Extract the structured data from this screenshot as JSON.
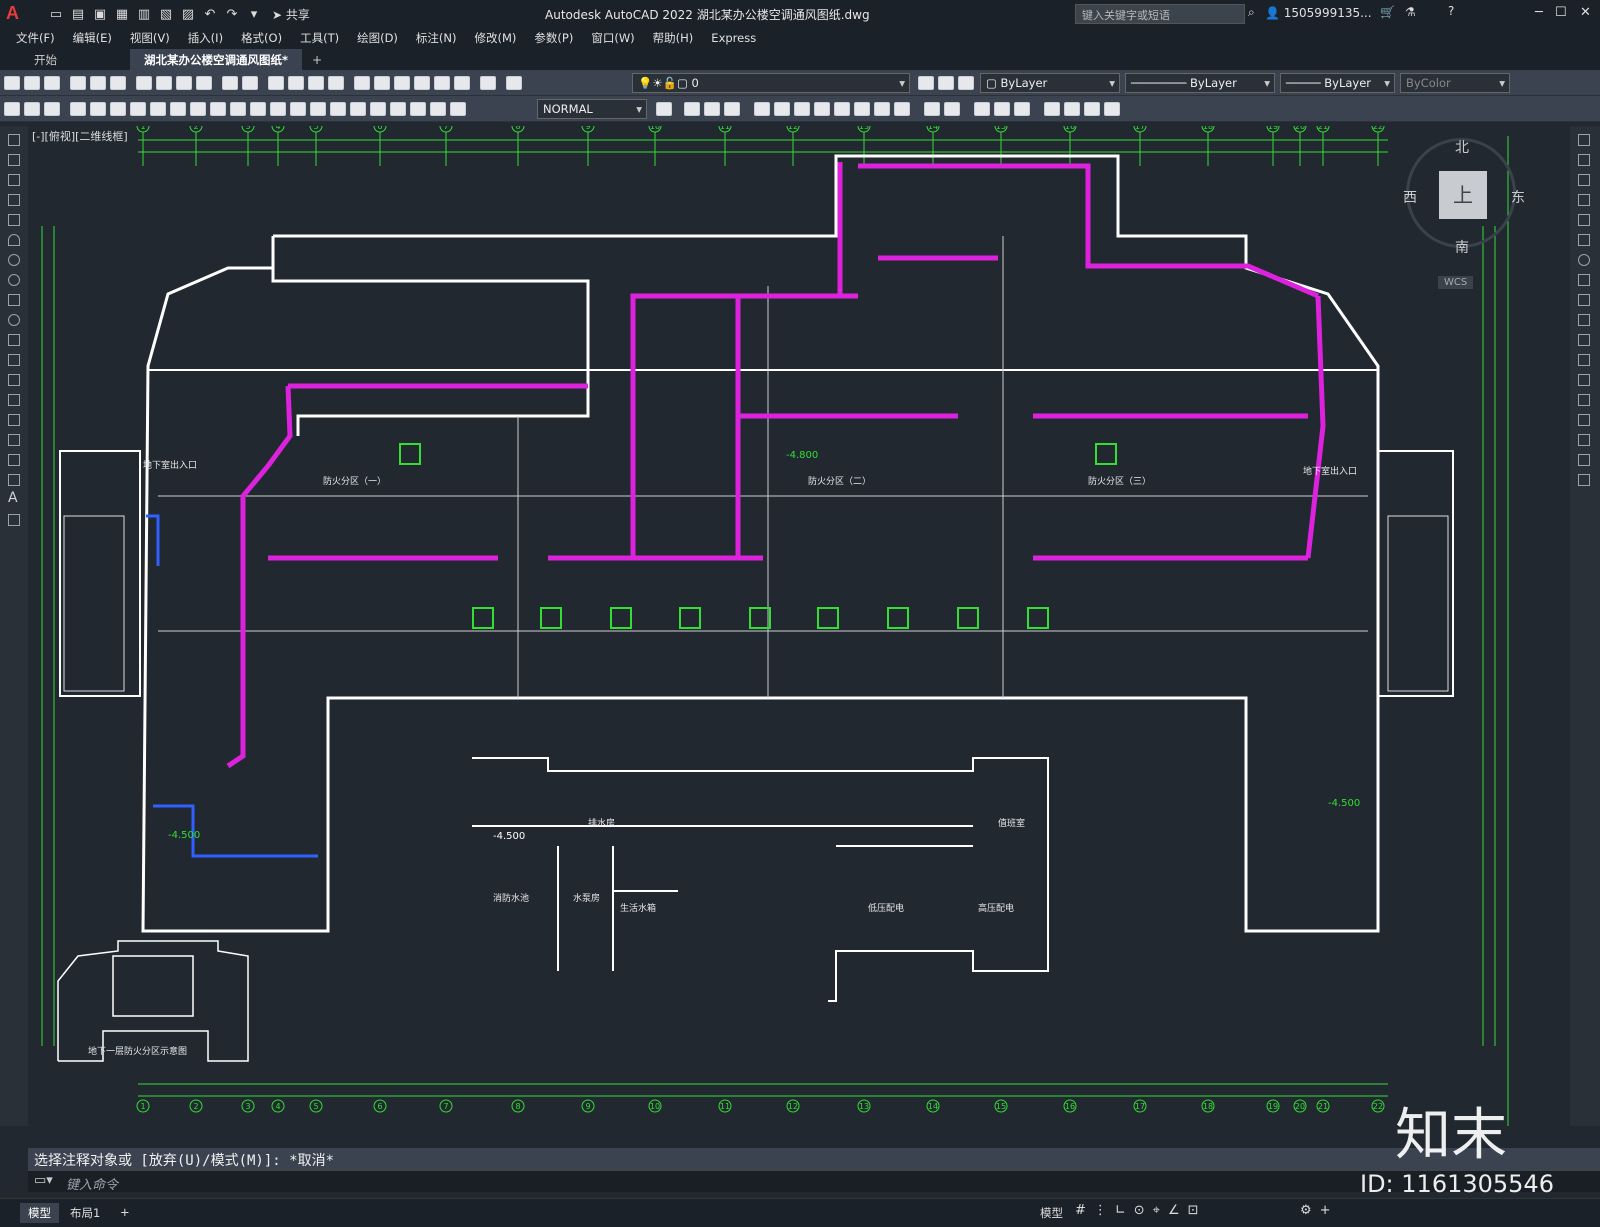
{
  "titlebar": {
    "logo": "A",
    "share": "共享",
    "title": "Autodesk AutoCAD 2022    湖北某办公楼空调通风图纸.dwg",
    "search_placeholder": "键入关键字或短语",
    "user": "1505999135...",
    "min": "─",
    "max": "☐",
    "close": "✕"
  },
  "menu": [
    "文件(F)",
    "编辑(E)",
    "视图(V)",
    "插入(I)",
    "格式(O)",
    "工具(T)",
    "绘图(D)",
    "标注(N)",
    "修改(M)",
    "参数(P)",
    "窗口(W)",
    "帮助(H)",
    "Express"
  ],
  "tabs": {
    "start": "开始",
    "doc": "湖北某办公楼空调通风图纸*",
    "add": "+"
  },
  "layer_combo": "0",
  "color_combo": "ByLayer",
  "linetype_combo": "ByLayer",
  "lineweight_combo": "ByLayer",
  "plotstyle_combo": "ByColor",
  "style_combo": "NORMAL",
  "viewport_label": "[-][俯视][二维线框]",
  "viewcube": {
    "north": "北",
    "south": "南",
    "east": "东",
    "west": "西",
    "top": "上",
    "wcs": "WCS"
  },
  "drawing": {
    "level1": "-4.800",
    "level2": "-4.500",
    "level3": "-4.500",
    "level4": "-4.500",
    "zone1": "防火分区（一）",
    "zone2": "防火分区（二）",
    "zone3": "防火分区（三）",
    "entry_left": "地下室出入口",
    "entry_right": "地下室出入口",
    "room1": "消防水池",
    "room2": "水泵房",
    "room3": "生活水箱",
    "room4": "低压配电",
    "room5": "高压配电",
    "room6": "值班室",
    "room7": "排水房",
    "inset_caption": "地下一层防火分区示意图",
    "axis_labels": [
      "1",
      "2",
      "3",
      "4",
      "5",
      "6",
      "7",
      "8",
      "9",
      "10",
      "11",
      "12",
      "13",
      "14",
      "15",
      "16",
      "17",
      "18",
      "19",
      "20",
      "21",
      "22"
    ]
  },
  "command_history": "选择注释对象或 [放弃(U)/模式(M)]: *取消*",
  "command_placeholder": "键入命令",
  "layout_tabs": [
    "模型",
    "布局1",
    "+"
  ],
  "status_model": "模型",
  "watermark": {
    "brand": "知末",
    "id": "ID: 1161305546"
  }
}
